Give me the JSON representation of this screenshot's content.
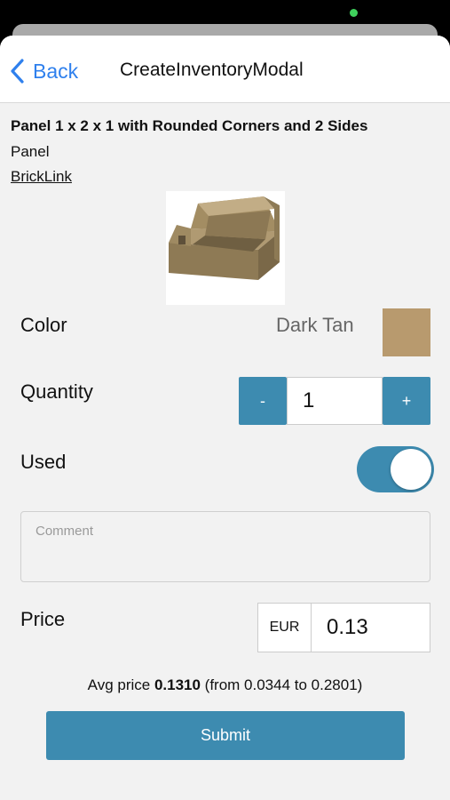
{
  "navbar": {
    "back_label": "Back",
    "title": "CreateInventoryModal"
  },
  "part": {
    "name": "Panel 1 x 2 x 1 with Rounded Corners and 2 Sides",
    "category": "Panel",
    "link_label": "BrickLink",
    "image": "panel-brick-image"
  },
  "color": {
    "label": "Color",
    "value": "Dark Tan",
    "swatch_hex": "#b89a6e"
  },
  "quantity": {
    "label": "Quantity",
    "minus_label": "-",
    "value": "1",
    "plus_label": "+"
  },
  "used": {
    "label": "Used",
    "on": true
  },
  "comment": {
    "placeholder": "Comment"
  },
  "price": {
    "label": "Price",
    "currency": "EUR",
    "value": "0.13"
  },
  "avg_price": {
    "prefix": "Avg price ",
    "value": "0.1310",
    "range": " (from 0.0344 to 0.2801)"
  },
  "submit_label": "Submit",
  "theme": {
    "accent": "#3d8bb0",
    "link_blue": "#2f80ed",
    "status_green": "#3fd15c"
  }
}
